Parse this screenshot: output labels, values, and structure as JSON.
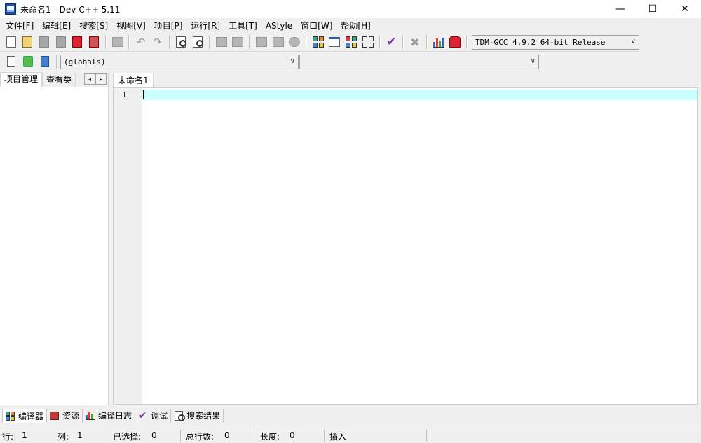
{
  "window": {
    "title": "未命名1 - Dev-C++ 5.11",
    "minimize": "—",
    "maximize": "☐",
    "close": "✕"
  },
  "menu": [
    "文件[F]",
    "编辑[E]",
    "搜索[S]",
    "视图[V]",
    "项目[P]",
    "运行[R]",
    "工具[T]",
    "AStyle",
    "窗口[W]",
    "帮助[H]"
  ],
  "toolbar": {
    "compiler_select": "TDM-GCC 4.9.2 64-bit Release",
    "scope_select": "(globals)",
    "function_select": "",
    "icons": [
      "new-file",
      "open-file",
      "save",
      "save-all",
      "close-file",
      "close-all",
      "print",
      "undo",
      "redo",
      "find",
      "replace",
      "goto-back",
      "goto-forward",
      "indent",
      "unindent",
      "toggle-comment",
      "compile",
      "run",
      "compile-run",
      "rebuild",
      "syntax-check",
      "stop",
      "chart",
      "debug"
    ]
  },
  "left_panel": {
    "tabs": [
      "项目管理",
      "查看类"
    ],
    "arrow_left": "◂",
    "arrow_right": "▸"
  },
  "editor": {
    "tab": "未命名1",
    "line_number": "1"
  },
  "bottom_tabs": [
    "编译器",
    "资源",
    "编译日志",
    "调试",
    "搜索结果"
  ],
  "status": {
    "row_label": "行:",
    "row_value": "1",
    "col_label": "列:",
    "col_value": "1",
    "sel_label": "已选择:",
    "sel_value": "0",
    "lines_label": "总行数:",
    "lines_value": "0",
    "len_label": "长度:",
    "len_value": "0",
    "mode": "插入"
  },
  "colors": {
    "current_line": "#ccffff",
    "gutter": "#f0f0f0",
    "chrome": "#f0f0f0"
  }
}
